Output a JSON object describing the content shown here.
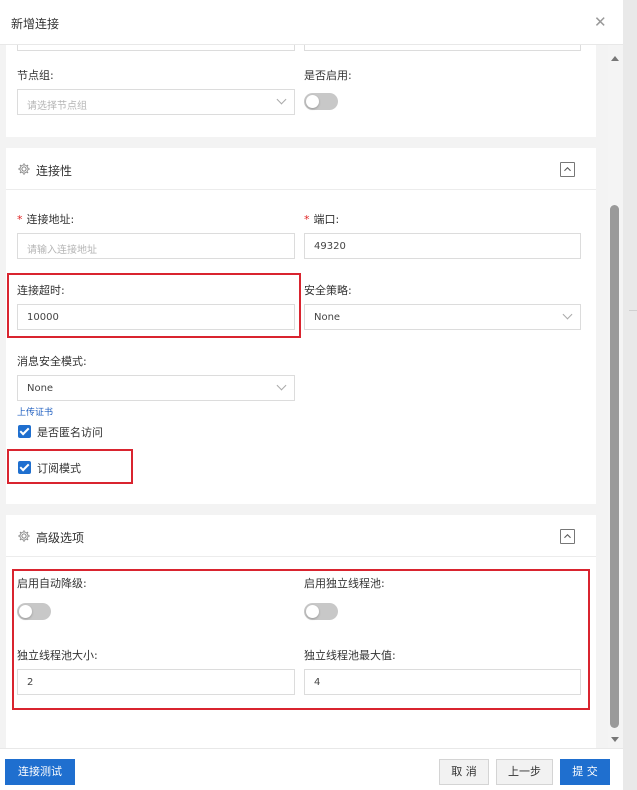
{
  "dialog": {
    "title": "新增连接",
    "close_icon": "close-icon"
  },
  "basic": {
    "node_group_label": "节点组:",
    "node_group_placeholder": "请选择节点组",
    "enabled_label": "是否启用:",
    "enabled": false
  },
  "connectivity": {
    "title": "连接性",
    "address_label": "连接地址:",
    "address_placeholder": "请输入连接地址",
    "port_label": "端口:",
    "port_value": "49320",
    "timeout_label": "连接超时:",
    "timeout_value": "10000",
    "security_policy_label": "安全策略:",
    "security_policy_value": "None",
    "message_security_label": "消息安全模式:",
    "message_security_value": "None",
    "upload_cert_link": "上传证书",
    "anonymous_label": "是否匿名访问",
    "anonymous_checked": true,
    "subscription_label": "订阅模式",
    "subscription_checked": true
  },
  "advanced": {
    "title": "高级选项",
    "auto_degrade_label": "启用自动降级:",
    "auto_degrade": false,
    "independent_pool_label": "启用独立线程池:",
    "independent_pool": false,
    "pool_size_label": "独立线程池大小:",
    "pool_size_value": "2",
    "pool_max_label": "独立线程池最大值:",
    "pool_max_value": "4"
  },
  "footer": {
    "test_button": "连接测试",
    "cancel_button": "取 消",
    "prev_button": "上一步",
    "submit_button": "提 交"
  },
  "colors": {
    "primary": "#1f6fcf",
    "highlight": "#d9242f",
    "required": "#e02424"
  }
}
